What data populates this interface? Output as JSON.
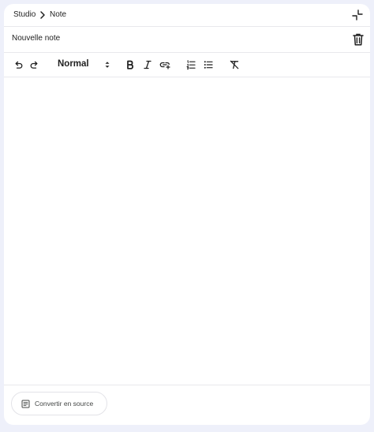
{
  "breadcrumb": {
    "root": "Studio",
    "current": "Note"
  },
  "note": {
    "title": "Nouvelle note",
    "body": ""
  },
  "toolbar": {
    "text_style": "Normal",
    "buttons": [
      {
        "name": "undo",
        "icon": "undo-icon"
      },
      {
        "name": "redo",
        "icon": "redo-icon"
      },
      {
        "name": "bold",
        "icon": "bold-icon"
      },
      {
        "name": "italic",
        "icon": "italic-icon"
      },
      {
        "name": "link",
        "icon": "link-icon"
      },
      {
        "name": "numbered-list",
        "icon": "numbered-list-icon"
      },
      {
        "name": "bulleted-list",
        "icon": "bulleted-list-icon"
      },
      {
        "name": "clear-formatting",
        "icon": "clear-formatting-icon"
      }
    ]
  },
  "footer": {
    "convert_label": "Convertir en source"
  },
  "colors": {
    "background": "#eef0fa",
    "panel": "#ffffff",
    "text": "#1f1f1f",
    "divider": "#e8e8ec"
  }
}
